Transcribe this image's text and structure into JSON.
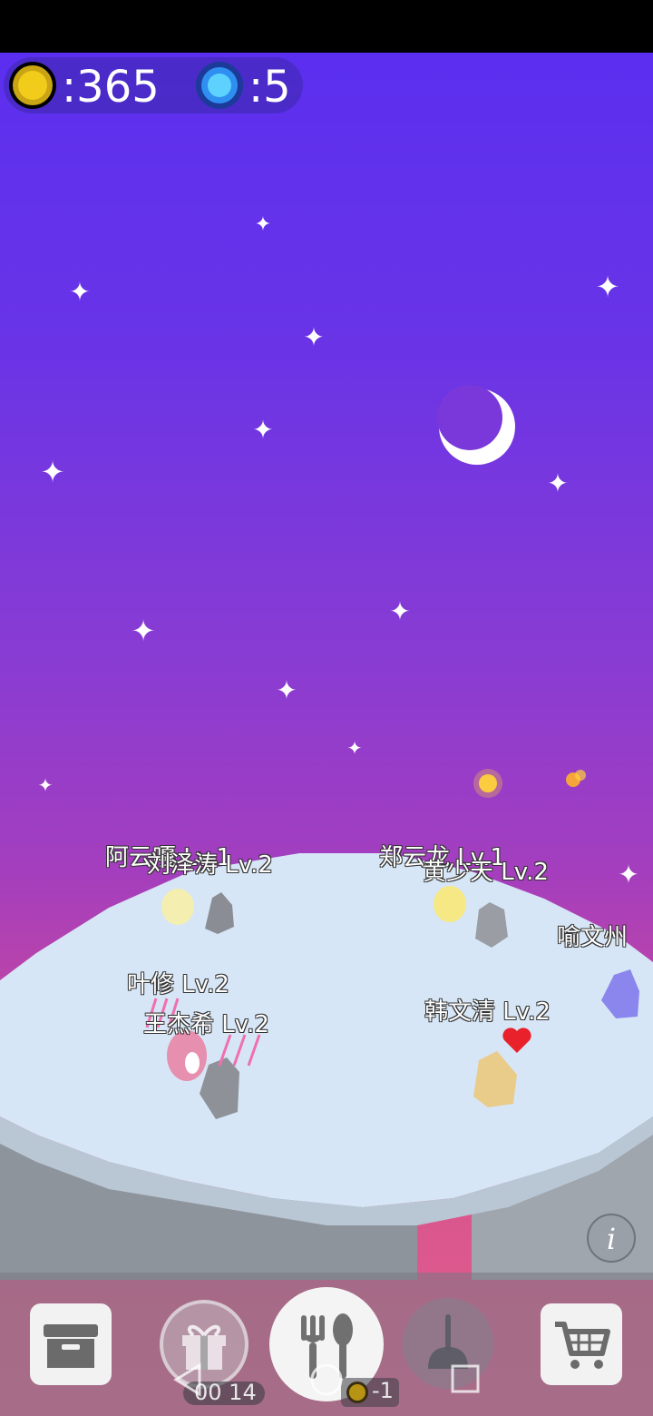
{
  "currency": {
    "coins": ":365",
    "gems": ":5",
    "coin_icon": "gold-coin-icon",
    "gem_icon": "blue-gem-icon"
  },
  "characters": [
    {
      "name": "阿云嘎",
      "level": "Lv.1"
    },
    {
      "name": "刘泽涛",
      "level": "Lv.2"
    },
    {
      "name": "郑云龙",
      "level": "Lv.1"
    },
    {
      "name": "黄少天",
      "level": "Lv.2"
    },
    {
      "name": "喻文州",
      "level": ""
    },
    {
      "name": "叶修",
      "level": "Lv.2"
    },
    {
      "name": "王杰希",
      "level": "Lv.2"
    },
    {
      "name": "韩文清",
      "level": "Lv.2"
    }
  ],
  "toolbar": {
    "items": [
      {
        "icon": "storage-box-icon"
      },
      {
        "icon": "gift-icon"
      },
      {
        "icon": "fork-spoon-icon"
      },
      {
        "icon": "plunger-icon"
      },
      {
        "icon": "shopping-cart-icon"
      }
    ],
    "timer": "00 14",
    "coin_delta": "-1"
  },
  "info_icon": "info-icon",
  "colors": {
    "sky_top": "#5b2ff0",
    "sky_bottom": "#e06090",
    "island": "#d6e6f6"
  }
}
